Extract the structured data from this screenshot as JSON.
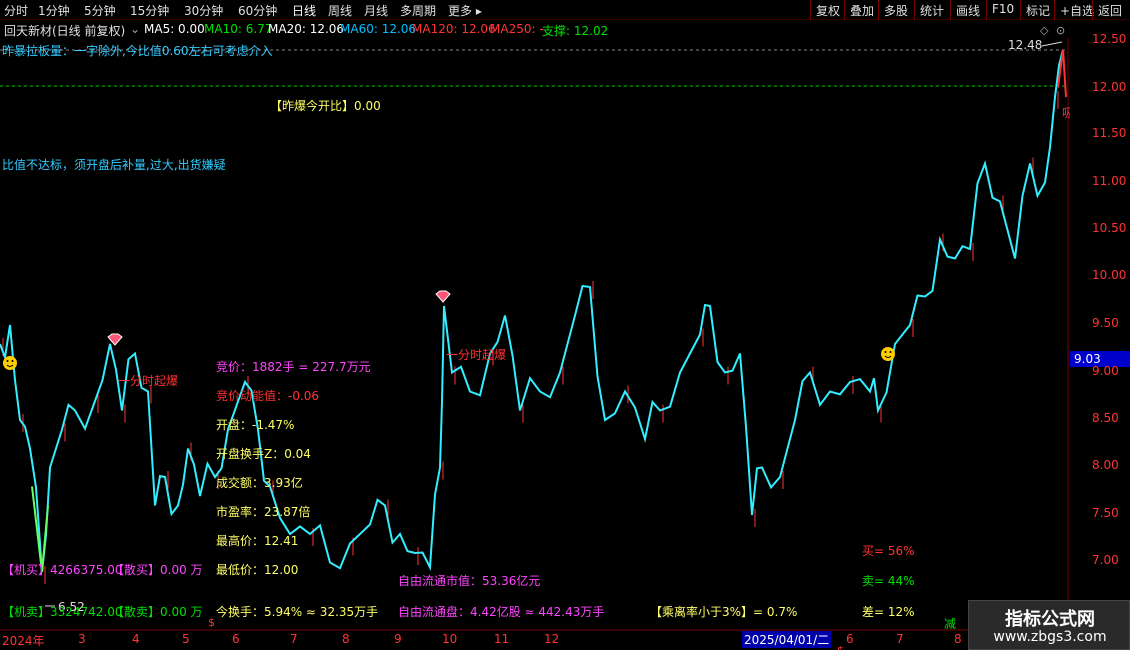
{
  "toolbar": {
    "periods": [
      "分时",
      "1分钟",
      "5分钟",
      "15分钟",
      "30分钟",
      "60分钟",
      "日线",
      "周线",
      "月线",
      "多周期",
      "更多 ▸"
    ],
    "right_buttons": [
      "复权",
      "叠加",
      "多股",
      "统计",
      "画线",
      "F10",
      "标记",
      "+自选",
      "返回"
    ]
  },
  "ma_bar": {
    "title": "回天新材(日线 前复权)",
    "ma5": "MA5: 0.00",
    "ma10": "MA10: 6.77",
    "ma20": "MA20: 12.06",
    "ma60": "MA60: 12.06",
    "ma120": "MA120: 12.06",
    "ma250": "MA250: -",
    "support": "支撑: 12.02",
    "colors": {
      "ma5": "#ffffff",
      "ma10": "#00e000",
      "ma20": "#ffffff",
      "ma60": "#00c0ff",
      "ma120": "#ff3333",
      "ma250": "#ff3333",
      "support": "#00e000"
    }
  },
  "annotations": {
    "line1": "昨暴拉板量：一字除外,今比值0.60左右可考虑介入",
    "yesterday_ratio": "【昨爆今开比】0.00",
    "ratio_warning": "比值不达标，须开盘后补量,过大,出货嫌疑",
    "explode1": "一分时起爆",
    "explode2": "一分时起爆",
    "suck": "吸筹"
  },
  "stats_panel": {
    "bid": "竞价：1882手 = 227.7万元",
    "bid_energy": "竞价动能值：-0.06",
    "open_gain": "开盘：-1.47%",
    "open_turnover": "开盘换手Z：0.04",
    "volume": "成交额：3.93亿",
    "pe": "市盈率：23.87倍",
    "high": "最高价：12.41",
    "low": "最低价：12.00",
    "free_float_value": "自由流通市值：53.36亿元",
    "institution_buy": "【机买】4266375.00",
    "retail_buy": "【散买】0.00 万",
    "institution_sell": "【机卖】3324742.00",
    "retail_sell": "【散卖】0.00 万",
    "turnover": "今换手：5.94% ≈ 32.35万手",
    "free_float_shares": "自由流通盘：4.42亿股 ≈ 442.43万手",
    "deviation": "【乘离率小于3%】= 0.7%",
    "buy_pct": "买= 56%",
    "sell_pct": "卖= 44%",
    "diff_pct": "差= 12%",
    "reduce": "减"
  },
  "price_markers": {
    "high_label": "12.48",
    "low_label": "6.52",
    "current": "9.03"
  },
  "y_axis": [
    "12.50",
    "12.00",
    "11.50",
    "11.00",
    "10.50",
    "10.00",
    "9.50",
    "9.00",
    "8.50",
    "8.00",
    "7.50",
    "7.00"
  ],
  "x_axis": {
    "labels": [
      "2024年",
      "3",
      "4",
      "5",
      "6",
      "7",
      "8",
      "9",
      "10",
      "11",
      "12",
      "6",
      "7",
      "8"
    ],
    "cursor_date": "2025/04/01/二"
  },
  "watermark": {
    "title": "指标公式网",
    "url": "www.zbgs3.com"
  },
  "colors": {
    "price_line": "#33eeff",
    "volume_tick": "#ff3333",
    "stats_magenta": "#ff44ff",
    "stats_yellow": "#ffff66",
    "cyan_text": "#33ccff"
  }
}
